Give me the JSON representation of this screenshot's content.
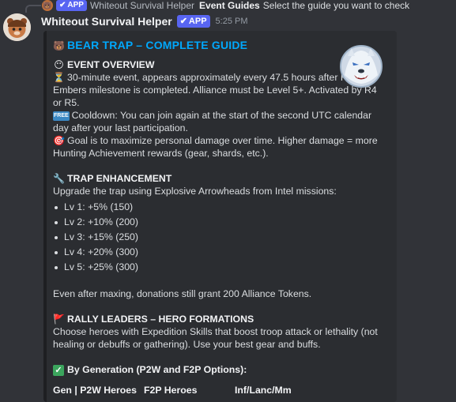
{
  "reply": {
    "app_badge": "APP",
    "name": "Whiteout Survival Helper",
    "command": "Event Guides",
    "text": "Select the guide you want to check"
  },
  "message": {
    "username": "Whiteout Survival Helper",
    "app_badge": "APP",
    "time": "5:25 PM"
  },
  "embed": {
    "title": "BEAR TRAP – COMPLETE GUIDE",
    "overview": {
      "heading": "EVENT OVERVIEW",
      "line1": "30-minute event, appears approximately every 47.5 hours after Kindling Embers milestone is completed. Alliance must be Level 5+. Activated by R4 or R5.",
      "line2": "Cooldown: You can join again at the start of the second UTC calendar day after your last participation.",
      "line3": "Goal is to maximize personal damage over time. Higher damage = more Hunting Achievement rewards (gear, shards, etc.)."
    },
    "trap": {
      "heading": "TRAP ENHANCEMENT",
      "intro": "Upgrade the trap using Explosive Arrowheads from Intel missions:",
      "levels": [
        "Lv 1: +5% (150)",
        "Lv 2: +10% (200)",
        "Lv 3: +15% (250)",
        "Lv 4: +20% (300)",
        "Lv 5: +25% (300)"
      ],
      "after": "Even after maxing, donations still grant 200 Alliance Tokens."
    },
    "rally": {
      "heading": "RALLY LEADERS – HERO FORMATIONS",
      "text": "Choose heroes with Expedition Skills that boost troop attack or lethality (not healing or debuffs or gathering). Use your best gear and buffs."
    },
    "generation": {
      "heading": "By Generation (P2W and F2P Options):",
      "columns": [
        "Gen | P2W Heroes",
        "F2P Heroes",
        "Inf/Lanc/Mm"
      ]
    }
  }
}
